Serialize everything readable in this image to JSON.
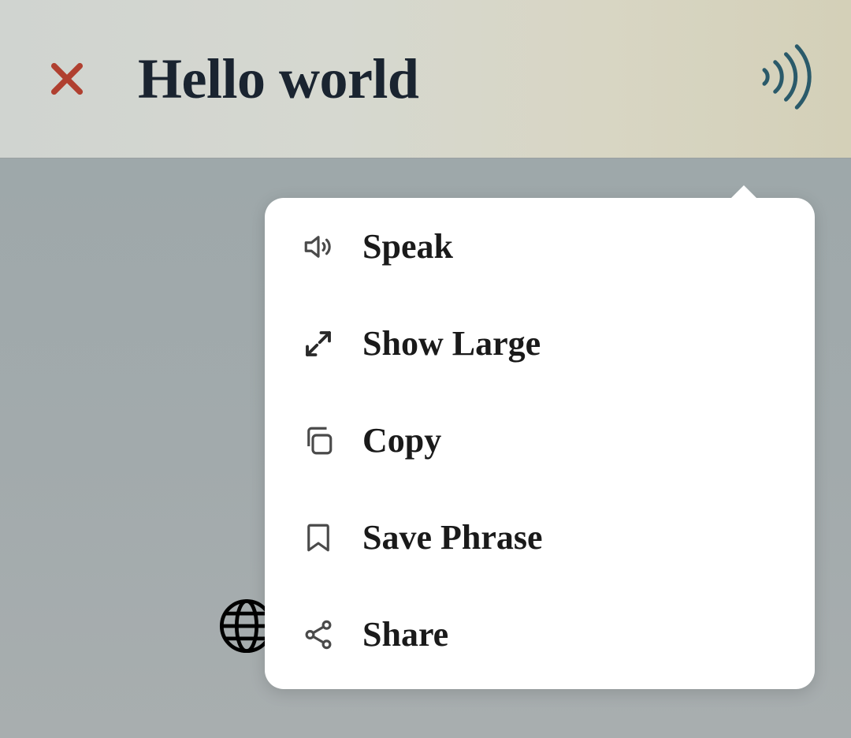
{
  "header": {
    "title": "Hello world"
  },
  "menu": {
    "items": [
      {
        "label": "Speak"
      },
      {
        "label": "Show Large"
      },
      {
        "label": "Copy"
      },
      {
        "label": "Save Phrase"
      },
      {
        "label": "Share"
      }
    ]
  }
}
